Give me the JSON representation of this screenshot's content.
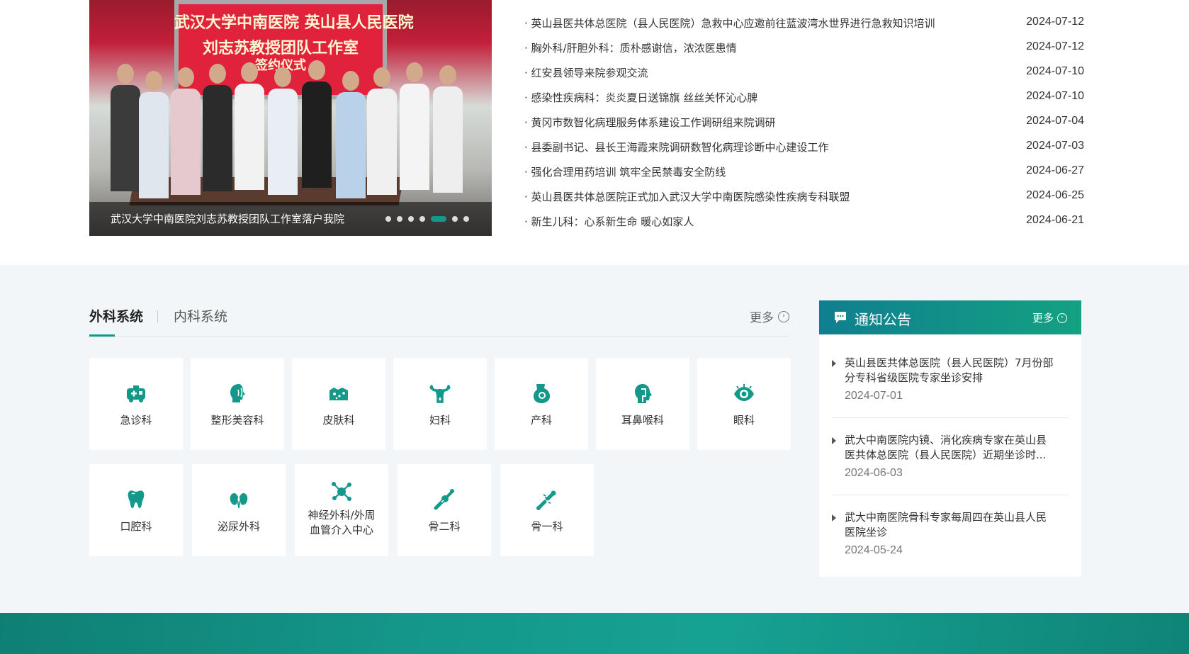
{
  "carousel": {
    "banner": {
      "line1": "武汉大学中南医院  英山县人民医院",
      "line2": "刘志苏教授团队工作室",
      "line3": "签约仪式"
    },
    "caption": "武汉大学中南医院刘志苏教授团队工作室落户我院",
    "dot_count": 7,
    "active_dot": 4
  },
  "news": [
    {
      "title": "· 英山县医共体总医院（县人民医院）急救中心应邀前往蓝波湾水世界进行急救知识培训",
      "date": "2024-07-12"
    },
    {
      "title": "· 胸外科/肝胆外科：质朴感谢信，浓浓医患情",
      "date": "2024-07-12"
    },
    {
      "title": "· 红安县领导来院参观交流",
      "date": "2024-07-10"
    },
    {
      "title": "· 感染性疾病科：炎炎夏日送锦旗 丝丝关怀沁心脾",
      "date": "2024-07-10"
    },
    {
      "title": "· 黄冈市数智化病理服务体系建设工作调研组来院调研",
      "date": "2024-07-04"
    },
    {
      "title": "· 县委副书记、县长王海霞来院调研数智化病理诊断中心建设工作",
      "date": "2024-07-03"
    },
    {
      "title": "· 强化合理用药培训 筑牢全民禁毒安全防线",
      "date": "2024-06-27"
    },
    {
      "title": "· 英山县医共体总医院正式加入武汉大学中南医院感染性疾病专科联盟",
      "date": "2024-06-25"
    },
    {
      "title": "· 新生儿科：心系新生命 暖心如家人",
      "date": "2024-06-21"
    }
  ],
  "departments": {
    "tabs": [
      "外科系统",
      "内科系统"
    ],
    "more": "更多",
    "row1": [
      {
        "label": "急诊科",
        "icon": "ambulance-icon"
      },
      {
        "label": "整形美容科",
        "icon": "face-profile-icon"
      },
      {
        "label": "皮肤科",
        "icon": "skin-icon"
      },
      {
        "label": "妇科",
        "icon": "uterus-icon"
      },
      {
        "label": "产科",
        "icon": "pregnancy-icon"
      },
      {
        "label": "耳鼻喉科",
        "icon": "head-throat-icon"
      },
      {
        "label": "眼科",
        "icon": "eye-icon"
      }
    ],
    "row2": [
      {
        "label": "口腔科",
        "icon": "tooth-icon"
      },
      {
        "label": "泌尿外科",
        "icon": "kidney-icon"
      },
      {
        "label": "神经外科/外周血管介入中心",
        "label_line1": "神经外科/外周",
        "label_line2": "血管介入中心",
        "icon": "neuron-icon"
      },
      {
        "label": "骨二科",
        "icon": "bone-joint-icon"
      },
      {
        "label": "骨一科",
        "icon": "bone-break-icon"
      }
    ]
  },
  "notices": {
    "title": "通知公告",
    "more": "更多",
    "items": [
      {
        "text": "英山县医共体总医院（县人民医院）7月份部分专科省级医院专家坐诊安排",
        "line1": "英山县医共体总医院（县人民医院）7月份部",
        "line2": "分专科省级医院专家坐诊安排",
        "date": "2024-07-01"
      },
      {
        "text": "武大中南医院内镜、消化疾病专家在英山县医共体总医院（县人民医院）近期坐诊时...",
        "line1": "武大中南医院内镜、消化疾病专家在英山县",
        "line2": "医共体总医院（县人民医院）近期坐诊时...",
        "date": "2024-06-03"
      },
      {
        "text": "武大中南医院骨科专家每周四在英山县人民医院坐诊",
        "line1": "武大中南医院骨科专家每周四在英山县人民",
        "line2": "医院坐诊",
        "date": "2024-05-24"
      }
    ]
  },
  "colors": {
    "accent": "#12998a",
    "notice_header": "#0f7f8f",
    "footer": "#14978a",
    "section_bg": "#f3f6f8"
  }
}
